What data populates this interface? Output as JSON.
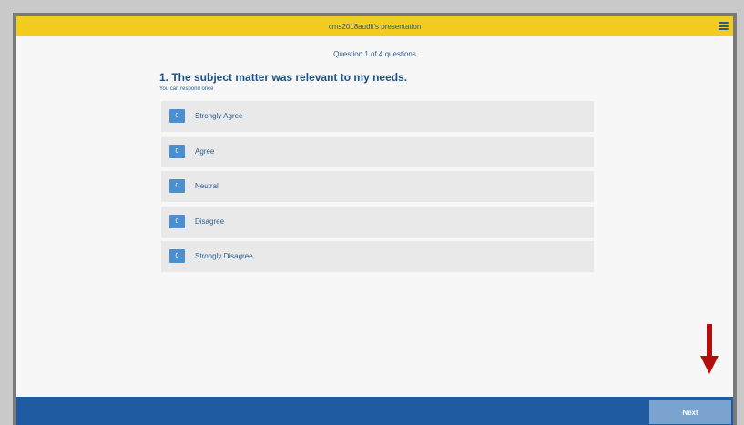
{
  "header": {
    "title": "cms2018audit's presentation",
    "menu_icon": "hamburger-menu-icon"
  },
  "question": {
    "progress": "Question 1 of 4 questions",
    "text": "1. The subject matter was relevant to my needs.",
    "hint": "You can respond once"
  },
  "options": [
    {
      "label": "Strongly Agree",
      "count": "0"
    },
    {
      "label": "Agree",
      "count": "0"
    },
    {
      "label": "Neutral",
      "count": "0"
    },
    {
      "label": "Disagree",
      "count": "0"
    },
    {
      "label": "Strongly Disagree",
      "count": "0"
    }
  ],
  "footer": {
    "next_label": "Next"
  },
  "colors": {
    "header_bg": "#f2cc1e",
    "footer_bg": "#1f5ba0",
    "badge_bg": "#4c8fd0",
    "arrow": "#b30f0f",
    "text_primary": "#1e4f84"
  }
}
